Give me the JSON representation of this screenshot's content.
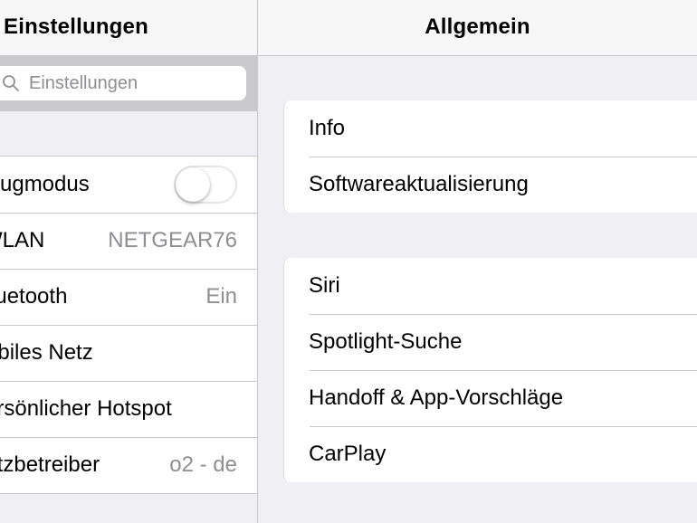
{
  "sidebar": {
    "title": "Einstellungen",
    "search_placeholder": "Einstellungen",
    "items": [
      {
        "label": "Flugmodus",
        "type": "toggle",
        "on": false
      },
      {
        "label": "WLAN",
        "value": "NETGEAR76"
      },
      {
        "label": "Bluetooth",
        "value": "Ein"
      },
      {
        "label": "Mobiles Netz",
        "value": ""
      },
      {
        "label": "Persönlicher Hotspot",
        "value": ""
      },
      {
        "label": "Netzbetreiber",
        "value": "o2 - de"
      }
    ]
  },
  "detail": {
    "title": "Allgemein",
    "groups": [
      {
        "items": [
          {
            "label": "Info"
          },
          {
            "label": "Softwareaktualisierung"
          }
        ]
      },
      {
        "items": [
          {
            "label": "Siri"
          },
          {
            "label": "Spotlight-Suche"
          },
          {
            "label": "Handoff & App-Vorschläge"
          },
          {
            "label": "CarPlay"
          }
        ]
      }
    ]
  },
  "colors": {
    "background": "#efeff4",
    "separator": "#c8c7cc",
    "secondary_text": "#8e8e93",
    "search_bar": "#c9c9ce"
  },
  "icons": [
    "search-icon"
  ]
}
